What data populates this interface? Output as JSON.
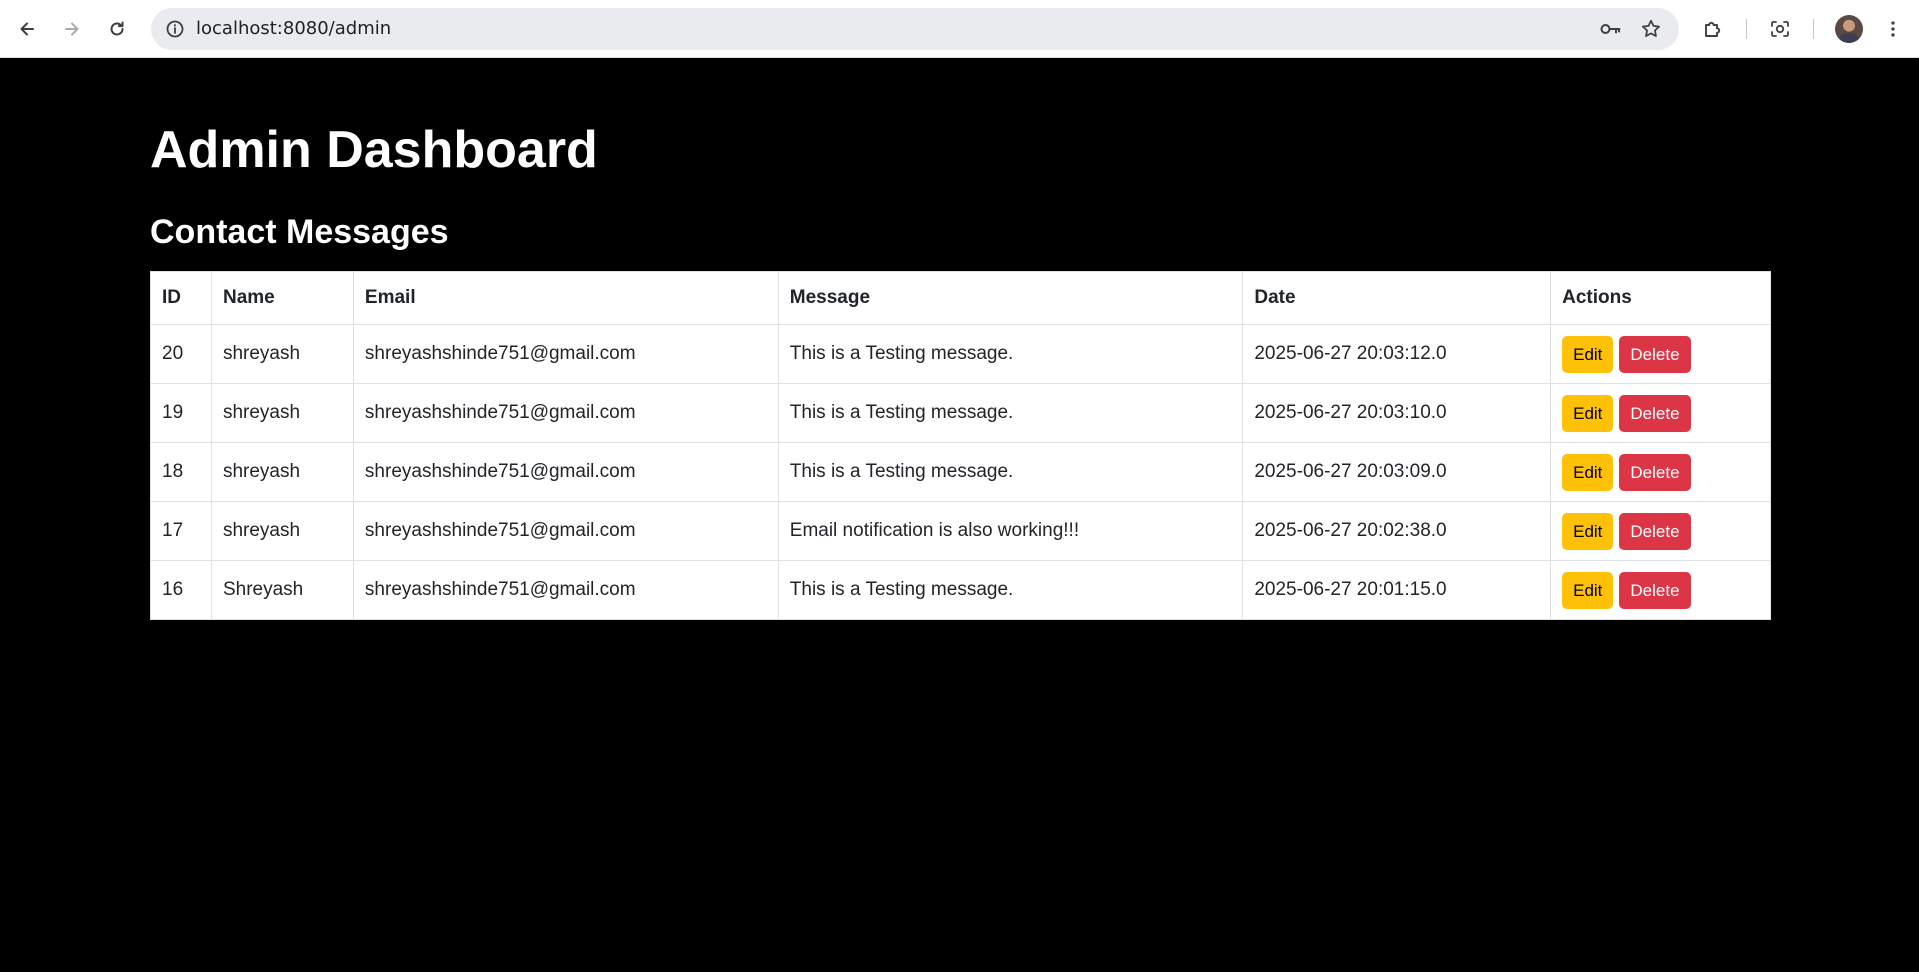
{
  "browser": {
    "url": "localhost:8080/admin"
  },
  "page": {
    "title": "Admin Dashboard",
    "section_title": "Contact Messages"
  },
  "table": {
    "headers": [
      "ID",
      "Name",
      "Email",
      "Message",
      "Date",
      "Actions"
    ],
    "rows": [
      {
        "id": "20",
        "name": "shreyash",
        "email": "shreyashshinde751@gmail.com",
        "message": "This is a Testing message.",
        "date": "2025-06-27 20:03:12.0",
        "edit": "Edit",
        "delete": "Delete"
      },
      {
        "id": "19",
        "name": "shreyash",
        "email": "shreyashshinde751@gmail.com",
        "message": "This is a Testing message.",
        "date": "2025-06-27 20:03:10.0",
        "edit": "Edit",
        "delete": "Delete"
      },
      {
        "id": "18",
        "name": "shreyash",
        "email": "shreyashshinde751@gmail.com",
        "message": "This is a Testing message.",
        "date": "2025-06-27 20:03:09.0",
        "edit": "Edit",
        "delete": "Delete"
      },
      {
        "id": "17",
        "name": "shreyash",
        "email": "shreyashshinde751@gmail.com",
        "message": "Email notification is also working!!!",
        "date": "2025-06-27 20:02:38.0",
        "edit": "Edit",
        "delete": "Delete"
      },
      {
        "id": "16",
        "name": "Shreyash",
        "email": "shreyashshinde751@gmail.com",
        "message": "This is a Testing message.",
        "date": "2025-06-27 20:01:15.0",
        "edit": "Edit",
        "delete": "Delete"
      }
    ]
  },
  "colors": {
    "page_background": "#000000",
    "edit_button": "#ffc107",
    "delete_button": "#dc3545"
  },
  "icons": {
    "back": "arrow-left-icon",
    "forward": "arrow-right-icon",
    "reload": "reload-icon",
    "site_info": "info-icon",
    "password": "key-icon",
    "bookmark": "star-icon",
    "extensions": "puzzle-icon",
    "screenshot": "camera-search-icon",
    "menu": "kebab-menu-icon"
  }
}
